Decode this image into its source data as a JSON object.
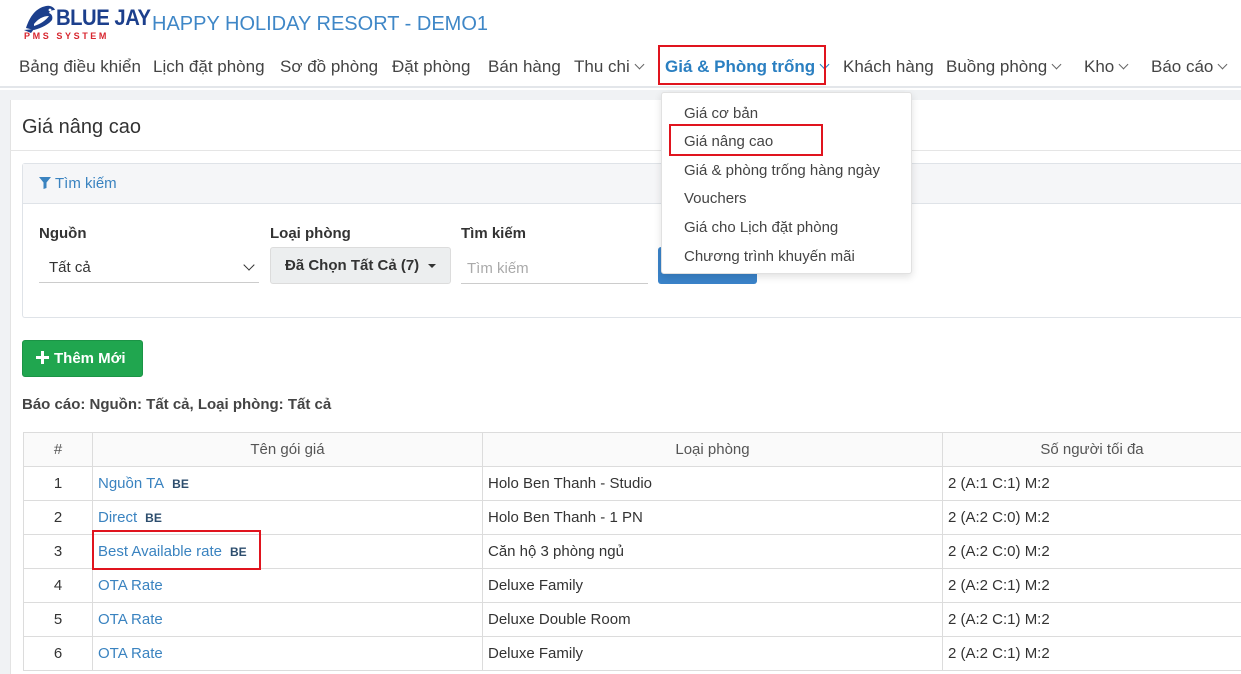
{
  "brand": {
    "logo_text": "BLUE JAY",
    "logo_sub": "PMS SYSTEM",
    "hotel_title": "HAPPY HOLIDAY RESORT - DEMO1"
  },
  "nav": {
    "items": [
      {
        "label": "Bảng điều khiển",
        "dropdown": false
      },
      {
        "label": "Lịch đặt phòng",
        "dropdown": false
      },
      {
        "label": "Sơ đồ phòng",
        "dropdown": false
      },
      {
        "label": "Đặt phòng",
        "dropdown": false
      },
      {
        "label": "Bán hàng",
        "dropdown": false
      },
      {
        "label": "Thu chi",
        "dropdown": true
      },
      {
        "label": "Giá & Phòng trống",
        "dropdown": true,
        "active": true
      },
      {
        "label": "Khách hàng",
        "dropdown": false
      },
      {
        "label": "Buồng phòng",
        "dropdown": true
      },
      {
        "label": "Kho",
        "dropdown": true
      },
      {
        "label": "Báo cáo",
        "dropdown": true
      }
    ]
  },
  "dropdown_menu": {
    "items": [
      "Giá cơ bản",
      "Giá nâng cao",
      "Giá & phòng trống hàng ngày",
      "Vouchers",
      "Giá cho Lịch đặt phòng",
      "Chương trình khuyến mãi"
    ],
    "highlighted": "Giá nâng cao"
  },
  "page": {
    "title": "Giá nâng cao"
  },
  "search": {
    "header": "Tìm kiếm",
    "source_label": "Nguồn",
    "source_value": "Tất cả",
    "room_type_label": "Loại phòng",
    "room_type_value": "Đã Chọn Tất Cả (7)",
    "query_label": "Tìm kiếm",
    "query_placeholder": "Tìm kiếm",
    "query_value": ""
  },
  "actions": {
    "add_label": "Thêm Mới"
  },
  "report_line": "Báo cáo: Nguồn: Tất cả, Loại phòng: Tất cả",
  "table": {
    "headers": [
      "#",
      "Tên gói giá",
      "Loại phòng",
      "Số người tối đa"
    ],
    "rows": [
      {
        "n": "1",
        "name": "Nguồn TA",
        "badge": "BE",
        "room": "Holo Ben Thanh - Studio",
        "max": "2 (A:1 C:1) M:2"
      },
      {
        "n": "2",
        "name": "Direct",
        "badge": "BE",
        "room": "Holo Ben Thanh - 1 PN",
        "max": "2 (A:2 C:0) M:2"
      },
      {
        "n": "3",
        "name": "Best Available rate",
        "badge": "BE",
        "room": "Căn hộ 3 phòng ngủ",
        "max": "2 (A:2 C:0) M:2"
      },
      {
        "n": "4",
        "name": "OTA Rate",
        "badge": "",
        "room": "Deluxe Family",
        "max": "2 (A:2 C:1) M:2"
      },
      {
        "n": "5",
        "name": "OTA Rate",
        "badge": "",
        "room": "Deluxe Double Room",
        "max": "2 (A:2 C:1) M:2"
      },
      {
        "n": "6",
        "name": "OTA Rate",
        "badge": "",
        "room": "Deluxe Family",
        "max": "2 (A:2 C:1) M:2"
      }
    ]
  },
  "colors": {
    "accent": "#3a83c0",
    "highlight_box": "#e0141e",
    "add_button": "#20a64f"
  }
}
